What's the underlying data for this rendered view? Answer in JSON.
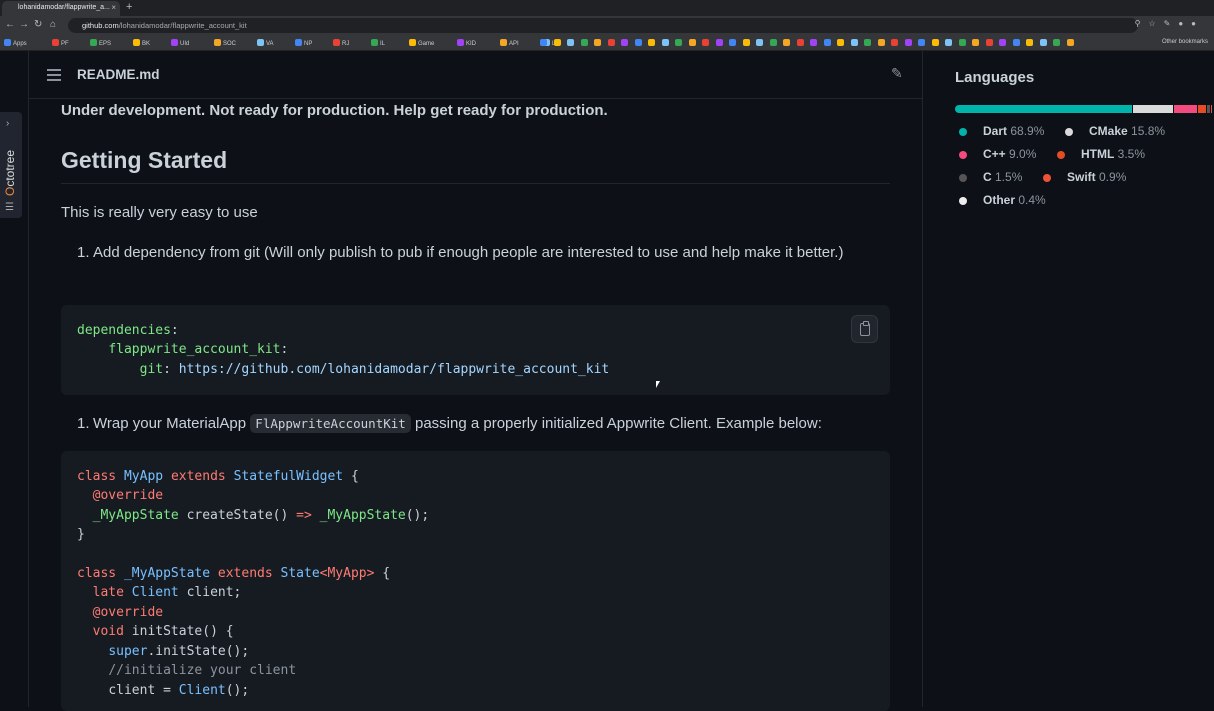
{
  "browser": {
    "tab_title": "lohanidamodar/flappwrite_a...",
    "tab_close": "×",
    "new_tab": "+",
    "url_host": "github.com",
    "url_path": "/lohanidamodar/flappwrite_account_kit",
    "bookmarks": [
      "Apps",
      "PF",
      "EPS",
      "BK",
      "UId",
      "SOC",
      "VA",
      "NP",
      "RJ",
      "IL",
      "Game",
      "KID",
      "API",
      "L"
    ],
    "other_bookmarks": "Other bookmarks"
  },
  "octotree": {
    "label_first": "O",
    "label_rest": "ctotree"
  },
  "readme": {
    "title": "README.md"
  },
  "content": {
    "notice": "Under development. Not ready for production. Help get ready for production.",
    "heading": "Getting Started",
    "intro": "This is really very easy to use",
    "step1_num": "1.",
    "step1_text": "Add dependency from git (Will only publish to pub if enough people are interested to use and help make it better.)",
    "step2_num": "1.",
    "step2_before": "Wrap your MaterialApp",
    "step2_code": "FlAppwriteAccountKit",
    "step2_after": "passing a properly initialized Appwrite Client. Example below:",
    "code1": {
      "l1_key": "dependencies",
      "l2_key": "flappwrite_account_kit",
      "l3_key": "git",
      "l3_val": "https://github.com/lohanidamodar/flappwrite_account_kit"
    },
    "code2": {
      "l1": [
        "class",
        "MyApp",
        "extends",
        "StatefulWidget",
        "{"
      ],
      "l2": "@override",
      "l3": [
        "_MyAppState",
        "createState",
        "()",
        "=>",
        "_MyAppState",
        "();"
      ],
      "l4": "}",
      "l6": [
        "class",
        "_MyAppState",
        "extends",
        "State",
        "<MyApp>",
        "{"
      ],
      "l7": [
        "late",
        "Client",
        "client;"
      ],
      "l8": "@override",
      "l9": [
        "void",
        "initState",
        "() {"
      ],
      "l10": [
        "super",
        ".initState();"
      ],
      "l11": "//initialize your client",
      "l12": [
        "client = ",
        "Client",
        "();"
      ]
    }
  },
  "languages": {
    "title": "Languages",
    "items": [
      {
        "name": "Dart",
        "pct": "68.9%",
        "value": 68.9,
        "color": "#00b4ab"
      },
      {
        "name": "CMake",
        "pct": "15.8%",
        "value": 15.8,
        "color": "#dadada"
      },
      {
        "name": "C++",
        "pct": "9.0%",
        "value": 9.0,
        "color": "#f34b7d"
      },
      {
        "name": "HTML",
        "pct": "3.5%",
        "value": 3.5,
        "color": "#e34c26"
      },
      {
        "name": "C",
        "pct": "1.5%",
        "value": 1.5,
        "color": "#555555"
      },
      {
        "name": "Swift",
        "pct": "0.9%",
        "value": 0.9,
        "color": "#F05138"
      },
      {
        "name": "Other",
        "pct": "0.4%",
        "value": 0.4,
        "color": "#ededed"
      }
    ]
  }
}
